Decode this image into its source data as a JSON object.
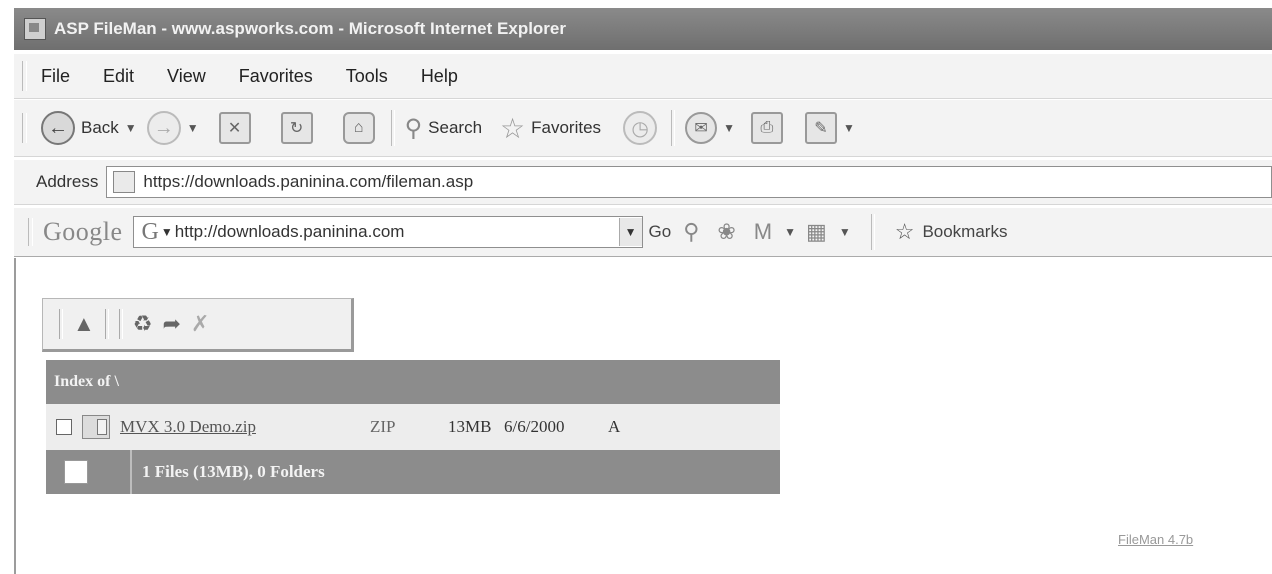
{
  "window": {
    "title": "ASP FileMan - www.aspworks.com - Microsoft Internet Explorer"
  },
  "menubar": {
    "items": [
      "File",
      "Edit",
      "View",
      "Favorites",
      "Tools",
      "Help"
    ]
  },
  "toolbar": {
    "back_label": "Back",
    "search_label": "Search",
    "favorites_label": "Favorites"
  },
  "address": {
    "label": "Address",
    "url": "https://downloads.paninina.com/fileman.asp"
  },
  "googlebar": {
    "logo": "Google",
    "search_value": "http://downloads.paninina.com",
    "go_label": "Go",
    "bookmarks_label": "Bookmarks"
  },
  "fileman": {
    "index_title": "Index of \\",
    "files": [
      {
        "name": "MVX 3.0 Demo.zip",
        "type": "ZIP",
        "size": "13MB",
        "date": "6/6/2000",
        "attr": "A"
      }
    ],
    "summary": "1 Files (13MB), 0 Folders",
    "version_link": "FileMan 4.7b"
  }
}
